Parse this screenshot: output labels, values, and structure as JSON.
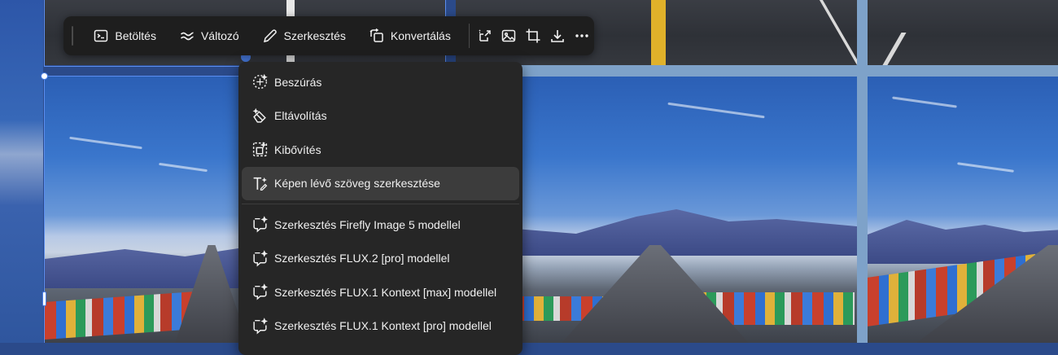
{
  "toolbar": {
    "load_label": "Betöltés",
    "variant_label": "Változó",
    "edit_label": "Szerkesztés",
    "convert_label": "Konvertálás",
    "icons": [
      "upscale-icon",
      "image-icon",
      "crop-icon",
      "download-icon",
      "more-icon"
    ]
  },
  "menu": {
    "items": [
      {
        "label": "Beszúrás",
        "icon": "insert-sparkle-icon"
      },
      {
        "label": "Eltávolítás",
        "icon": "erase-icon"
      },
      {
        "label": "Kibővítés",
        "icon": "expand-icon"
      },
      {
        "label": "Képen lévő szöveg szerkesztése",
        "icon": "text-edit-icon",
        "active": true
      }
    ],
    "model_items": [
      {
        "label": "Szerkesztés Firefly Image 5 modellel",
        "icon": "chat-sparkle-icon"
      },
      {
        "label": "Szerkesztés FLUX.2 [pro] modellel",
        "icon": "chat-sparkle-icon"
      },
      {
        "label": "Szerkesztés FLUX.1 Kontext [max] modellel",
        "icon": "chat-sparkle-icon"
      },
      {
        "label": "Szerkesztés FLUX.1 Kontext [pro] modellel",
        "icon": "chat-sparkle-icon"
      }
    ]
  },
  "colors": {
    "toolbar_bg": "#1e1e1e",
    "menu_bg": "#262626",
    "active_item_bg": "#3c3c3c",
    "selection_accent": "#5b8ef0"
  }
}
